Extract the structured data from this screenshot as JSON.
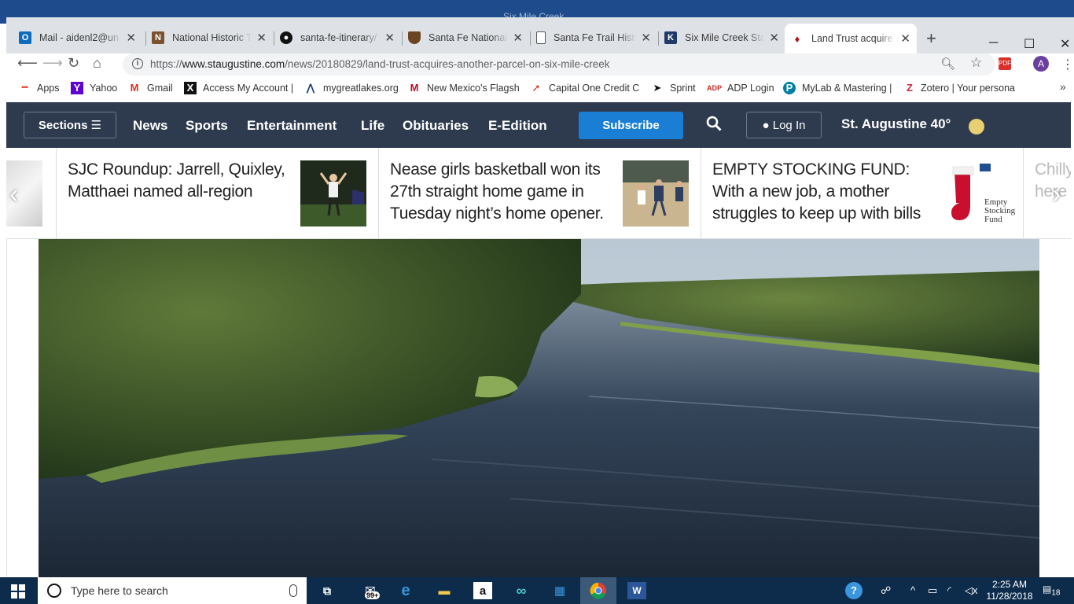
{
  "window": {
    "title": "Six Mile Creek"
  },
  "tabs": [
    {
      "label": "Mail - aidenl2@un",
      "icon": "outlook-icon",
      "color": "#0f6cbd",
      "glyph": "O"
    },
    {
      "label": "National Historic T",
      "icon": "book-icon",
      "color": "#7a5230",
      "glyph": "N"
    },
    {
      "label": "santa-fe-itinerary/",
      "icon": "github-icon",
      "color": "#111111",
      "glyph": "◉"
    },
    {
      "label": "Santa Fe National",
      "icon": "nps-shield-icon",
      "color": "#6b4423",
      "glyph": "▼"
    },
    {
      "label": "Santa Fe Trail Histo",
      "icon": "page-icon",
      "color": "#ffffff",
      "glyph": "▭"
    },
    {
      "label": "Six Mile Creek Sta",
      "icon": "k-icon",
      "color": "#1f3a68",
      "glyph": "K"
    },
    {
      "label": "Land Trust acquire",
      "icon": "record-icon",
      "color": "#b5121b",
      "glyph": "♦",
      "active": true
    }
  ],
  "address": {
    "scheme": "https://",
    "host": "www.staugustine.com",
    "path": "/news/20180829/land-trust-acquires-another-parcel-on-six-mile-creek"
  },
  "profile": {
    "initial": "A",
    "color": "#6b3fa0"
  },
  "bookmarks": [
    {
      "label": "Apps",
      "icon": "apps-grid-icon",
      "color": "#e94235",
      "glyph": "⋮⋮"
    },
    {
      "label": "Yahoo",
      "icon": "yahoo-icon",
      "color": "#5f01d1",
      "glyph": "Y"
    },
    {
      "label": "Gmail",
      "icon": "gmail-icon",
      "color": "#d93025",
      "glyph": "M"
    },
    {
      "label": "Access My Account |",
      "icon": "x-icon",
      "color": "#111111",
      "glyph": "X"
    },
    {
      "label": "mygreatlakes.org",
      "icon": "greatlakes-icon",
      "color": "#1d3f72",
      "glyph": "^"
    },
    {
      "label": "New Mexico's Flagsh",
      "icon": "unm-icon",
      "color": "#ba0c2f",
      "glyph": "M"
    },
    {
      "label": "Capital One Credit C",
      "icon": "capitalone-icon",
      "color": "#d22e1e",
      "glyph": "↗"
    },
    {
      "label": "Sprint",
      "icon": "sprint-icon",
      "color": "#111111",
      "glyph": "➤"
    },
    {
      "label": "ADP Login",
      "icon": "adp-icon",
      "color": "#d0271d",
      "glyph": "ADP"
    },
    {
      "label": "MyLab & Mastering |",
      "icon": "pearson-icon",
      "color": "#007fa3",
      "glyph": "P"
    },
    {
      "label": "Zotero | Your persona",
      "icon": "zotero-icon",
      "color": "#cc2936",
      "glyph": "Z"
    }
  ],
  "site_nav": {
    "sections": "Sections",
    "links": [
      "News",
      "Sports",
      "Entertainment",
      "Life",
      "Obituaries",
      "E-Edition"
    ],
    "subscribe": "Subscribe",
    "login": "Log In",
    "weather": "St. Augustine 40°"
  },
  "carousel": [
    {
      "title": "SJC Roundup: Jarrell, Quixley, Matthaei named all-region",
      "thumb": "soccer-photo"
    },
    {
      "title": "Nease girls basketball won its 27th straight home game in Tuesday night’s home opener.",
      "thumb": "basketball-photo"
    },
    {
      "title": "EMPTY STOCKING FUND: With a new job, a mother struggles to keep up with bills",
      "thumb": "stocking-photo",
      "thumb_text": [
        "Empty",
        "Stocking",
        "Fund"
      ]
    },
    {
      "title": "Chilly here",
      "thumb": "partial"
    }
  ],
  "hero": {
    "subject": "Six Mile Creek river photo"
  },
  "taskbar": {
    "search_placeholder": "Type here to search",
    "mail_badge": "99+",
    "time": "2:25 AM",
    "date": "11/28/2018",
    "notifications": "18"
  }
}
